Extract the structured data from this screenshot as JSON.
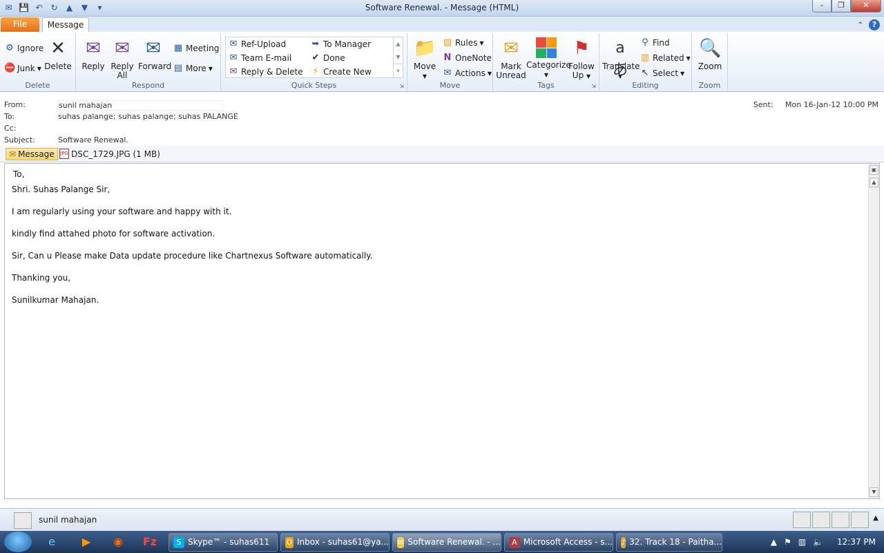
{
  "window": {
    "title": "Software Renewal. - Message (HTML)"
  },
  "tabs": {
    "file": "File",
    "message": "Message"
  },
  "ribbon": {
    "delete_group": {
      "label": "Delete",
      "ignore": "Ignore",
      "junk": "Junk",
      "delete": "Delete"
    },
    "respond_group": {
      "label": "Respond",
      "reply": "Reply",
      "reply_all_1": "Reply",
      "reply_all_2": "All",
      "forward": "Forward",
      "meeting": "Meeting",
      "more": "More"
    },
    "quicksteps_group": {
      "label": "Quick Steps",
      "items": [
        "Ref-Upload",
        "Team E-mail",
        "Reply & Delete",
        "To Manager",
        "Done",
        "Create New"
      ]
    },
    "move_group": {
      "label": "Move",
      "move": "Move",
      "rules": "Rules",
      "onenote": "OneNote",
      "actions": "Actions"
    },
    "tags_group": {
      "label": "Tags",
      "mark_unread_1": "Mark",
      "mark_unread_2": "Unread",
      "categorize": "Categorize",
      "follow_up_1": "Follow",
      "follow_up_2": "Up"
    },
    "editing_group": {
      "label": "Editing",
      "translate": "Translate",
      "find": "Find",
      "related": "Related",
      "select": "Select"
    },
    "zoom_group": {
      "label": "Zoom",
      "zoom": "Zoom"
    }
  },
  "header": {
    "from_label": "From:",
    "from_value": "sunil mahajan",
    "to_label": "To:",
    "to_value": "suhas palange; suhas palange; suhas PALANGE",
    "cc_label": "Cc:",
    "cc_value": "",
    "subject_label": "Subject:",
    "subject_value": "Software Renewal.",
    "sent_label": "Sent:",
    "sent_value": "Mon 16-Jan-12 10:00 PM"
  },
  "attachments": {
    "message_tab": "Message",
    "file": "DSC_1729.JPG (1 MB)"
  },
  "body": {
    "lines": [
      "To,",
      "Shri. Suhas Palange Sir,",
      "I am regularly using your software and happy with it.",
      "kindly find attahed photo for software activation.",
      "Sir, Can u Please make Data update procedure like Chartnexus Software automatically.",
      "Thanking you,",
      "Sunilkumar Mahajan."
    ]
  },
  "people_pane": {
    "name": "sunil mahajan"
  },
  "taskbar": {
    "items": [
      {
        "label": "Skype™ - suhas611",
        "color": "#00aff0"
      },
      {
        "label": "Inbox - suhas61@ya...",
        "color": "#e8a317"
      },
      {
        "label": "Software Renewal. - ...",
        "color": "#f2c94c"
      },
      {
        "label": "Microsoft Access - s...",
        "color": "#b03a48"
      },
      {
        "label": "32. Track 18 - Paitha...",
        "color": "#d9a441"
      }
    ],
    "clock": "12:37 PM"
  }
}
